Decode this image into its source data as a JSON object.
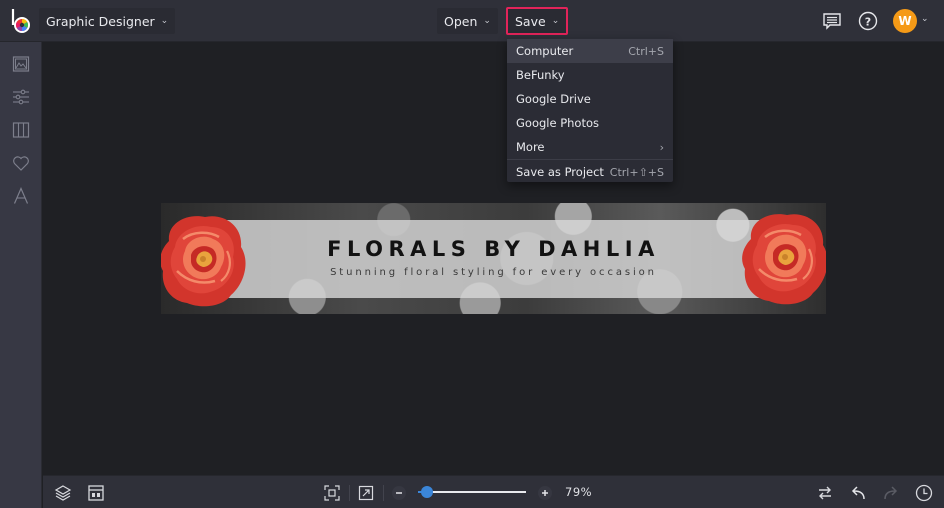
{
  "topbar": {
    "app_name": "Graphic Designer",
    "open_label": "Open",
    "save_label": "Save",
    "avatar_initial": "W"
  },
  "save_menu": {
    "items": [
      {
        "label": "Computer",
        "shortcut": "Ctrl+S",
        "active": true
      },
      {
        "label": "BeFunky",
        "shortcut": ""
      },
      {
        "label": "Google Drive",
        "shortcut": ""
      },
      {
        "label": "Google Photos",
        "shortcut": ""
      },
      {
        "label": "More",
        "shortcut": "›"
      },
      {
        "label": "Save as Project",
        "shortcut": "Ctrl+⇧+S"
      }
    ]
  },
  "sidebar": {
    "items": [
      {
        "icon": "image-icon"
      },
      {
        "icon": "sliders-icon"
      },
      {
        "icon": "columns-icon"
      },
      {
        "icon": "heart-icon"
      },
      {
        "icon": "text-icon"
      }
    ]
  },
  "canvas": {
    "banner_title": "FLORALS BY DAHLIA",
    "banner_subtitle": "Stunning floral styling for every occasion"
  },
  "bottombar": {
    "zoom_level": 0.79,
    "zoom_text": "79%"
  },
  "colors": {
    "save_highlight": "#e2245a",
    "avatar": "#f59a17",
    "slider_accent": "#3b86d9"
  }
}
